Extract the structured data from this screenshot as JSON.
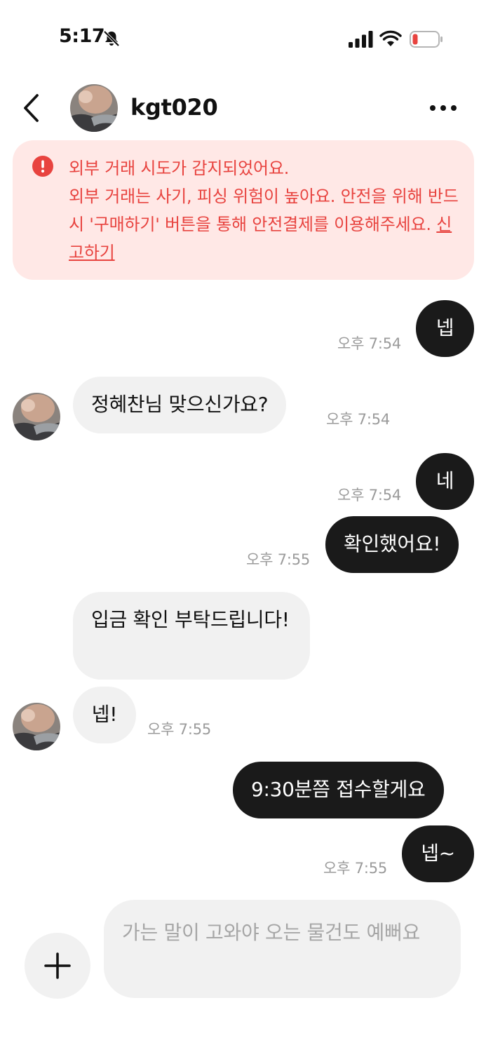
{
  "status_bar": {
    "time": "5:17",
    "icons": [
      "bell-slash-icon",
      "signal-icon",
      "wifi-icon",
      "battery-low-icon"
    ],
    "battery_color": "#e8433f"
  },
  "header": {
    "username": "kgt020",
    "icons": [
      "chevron-left-icon",
      "more-horizontal-icon"
    ]
  },
  "warning": {
    "line1": "외부 거래 시도가 감지되었어요.",
    "line2": "외부 거래는 사기, 피싱 위험이 높아요. 안전을 위해 반드시 '구매하기' 버튼을 통해 안전결제를 이용해주세요.",
    "report_link": "신고하기",
    "color": "#e8433f",
    "background": "#ffe8e6"
  },
  "messages": [
    {
      "direction": "out",
      "text": "넵",
      "time": "오후 7:54"
    },
    {
      "direction": "in",
      "text": "정혜찬님 맞으신가요?",
      "time": "오후 7:54"
    },
    {
      "direction": "out",
      "text": "네",
      "time": "오후 7:54"
    },
    {
      "direction": "out",
      "text": "확인했어요!",
      "time": "오후 7:55"
    },
    {
      "direction": "in",
      "text": "입금 확인 부탁드립니다!",
      "time": ""
    },
    {
      "direction": "in",
      "text": "넵!",
      "time": "오후 7:55"
    },
    {
      "direction": "out",
      "text": "9:30분쯤 접수할게요",
      "time": ""
    },
    {
      "direction": "out",
      "text": "넵~",
      "time": "오후 7:55"
    }
  ],
  "composer": {
    "placeholder": "가는 말이 고와야 오는 물건도 예뻐요",
    "add_icon": "plus-icon"
  },
  "colors": {
    "outgoing_bubble": "#1a1a1a",
    "incoming_bubble": "#f1f1f1",
    "timestamp": "#9b9b9b"
  }
}
